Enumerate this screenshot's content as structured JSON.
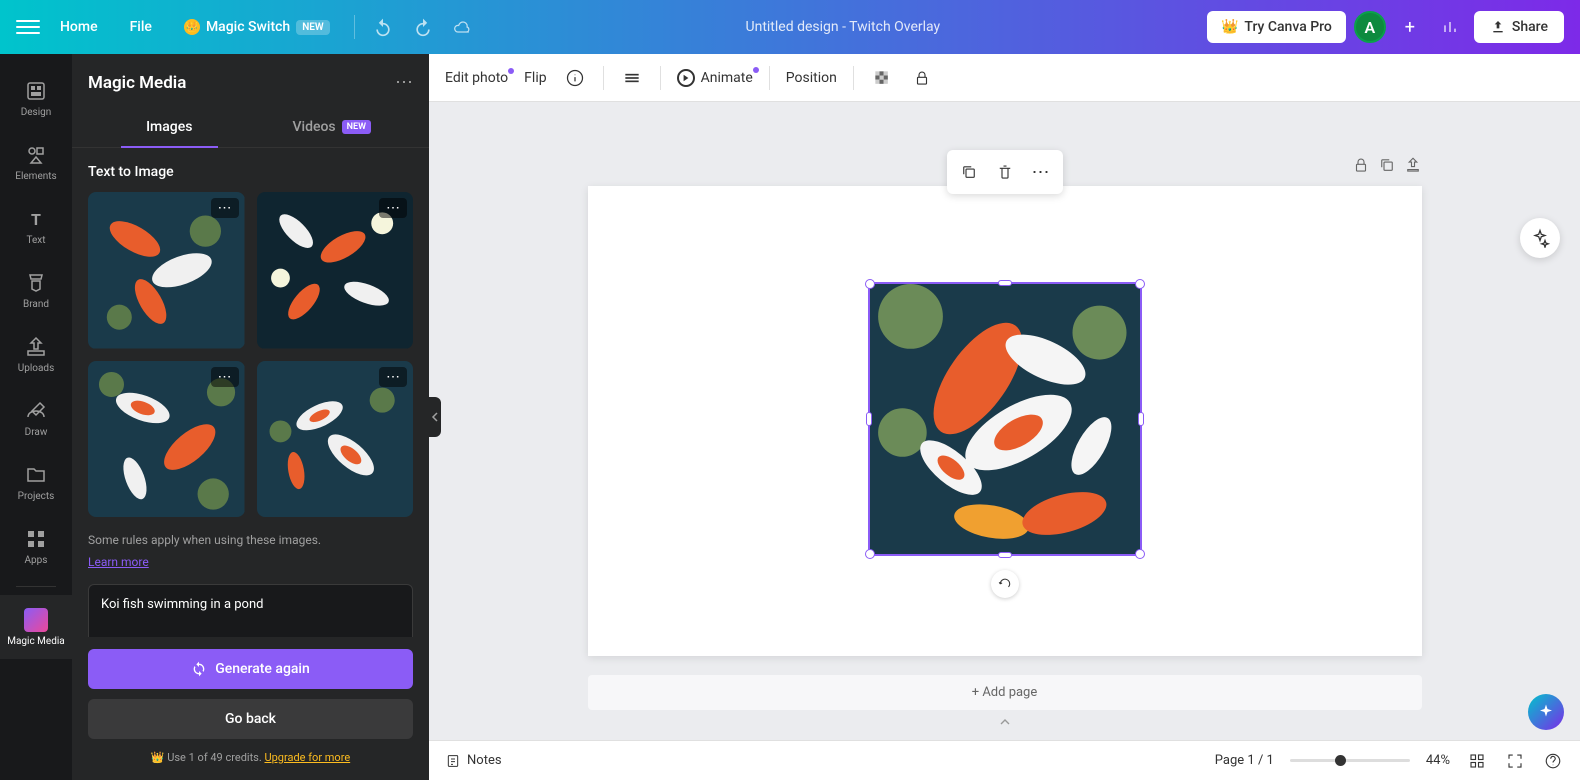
{
  "header": {
    "home": "Home",
    "file": "File",
    "magic_switch": "Magic Switch",
    "magic_switch_badge": "NEW",
    "design_title": "Untitled design - Twitch Overlay",
    "try_pro": "Try Canva Pro",
    "avatar_letter": "A",
    "share": "Share"
  },
  "nav_rail": {
    "items": [
      {
        "label": "Design"
      },
      {
        "label": "Elements"
      },
      {
        "label": "Text"
      },
      {
        "label": "Brand"
      },
      {
        "label": "Uploads"
      },
      {
        "label": "Draw"
      },
      {
        "label": "Projects"
      },
      {
        "label": "Apps"
      }
    ],
    "magic_media": "Magic Media"
  },
  "side_panel": {
    "title": "Magic Media",
    "tabs": {
      "images": "Images",
      "videos": "Videos",
      "videos_badge": "NEW"
    },
    "section_title": "Text to Image",
    "rules_text": "Some rules apply when using these images.",
    "learn_more": "Learn more",
    "prompt_value": "Koi fish swimming in a pond",
    "generate_btn": "Generate again",
    "go_back_btn": "Go back",
    "credits_used": "1",
    "credits_total": "49",
    "credits_prefix": "Use ",
    "credits_mid": " of ",
    "credits_suffix": " credits. ",
    "upgrade": "Upgrade for more"
  },
  "editor_toolbar": {
    "edit_photo": "Edit photo",
    "flip": "Flip",
    "animate": "Animate",
    "position": "Position"
  },
  "canvas": {
    "add_page": "+ Add page"
  },
  "bottom_bar": {
    "notes": "Notes",
    "page_current": "1",
    "page_total": "1",
    "page_label": "Page",
    "zoom_pct": "44%"
  }
}
